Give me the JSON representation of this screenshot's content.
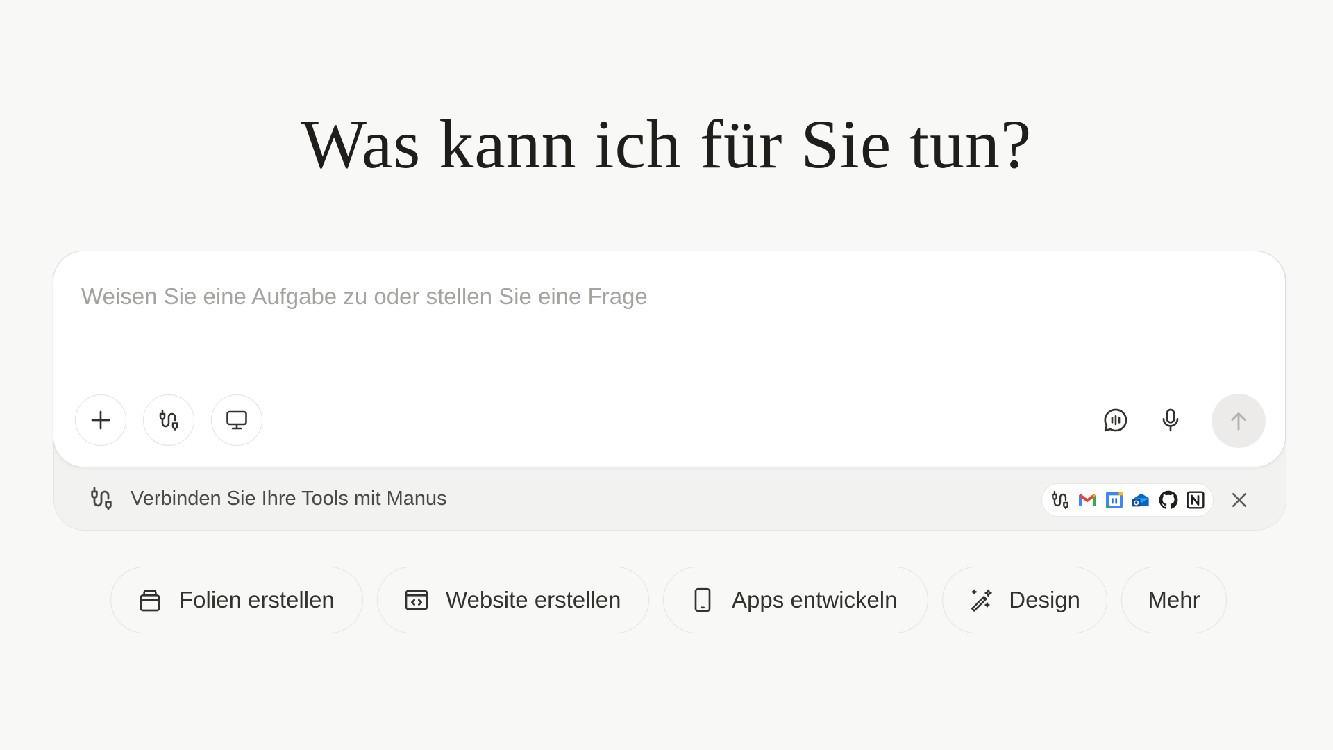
{
  "hero": {
    "title": "Was kann ich für Sie tun?"
  },
  "composer": {
    "placeholder": "Weisen Sie eine Aufgabe zu oder stellen Sie eine Frage",
    "value": "",
    "left_buttons": [
      {
        "name": "add-button",
        "icon": "plus-icon"
      },
      {
        "name": "connect-tools-button",
        "icon": "plug-connector-icon"
      },
      {
        "name": "computer-button",
        "icon": "monitor-icon"
      }
    ],
    "right_buttons": [
      {
        "name": "speech-button",
        "icon": "speech-bubble-audio-icon"
      },
      {
        "name": "microphone-button",
        "icon": "microphone-icon"
      },
      {
        "name": "send-button",
        "icon": "arrow-up-icon"
      }
    ]
  },
  "connect_bar": {
    "text": "Verbinden Sie Ihre Tools mit Manus",
    "tool_icons": [
      "connector-icon",
      "gmail-icon",
      "google-calendar-icon",
      "outlook-icon",
      "github-icon",
      "notion-icon"
    ],
    "close_icon": "close-icon"
  },
  "suggestions": [
    {
      "label": "Folien erstellen",
      "icon": "slides-icon"
    },
    {
      "label": "Website erstellen",
      "icon": "browser-code-icon"
    },
    {
      "label": "Apps entwickeln",
      "icon": "mobile-phone-icon"
    },
    {
      "label": "Design",
      "icon": "magic-pen-icon"
    },
    {
      "label": "Mehr",
      "icon": ""
    }
  ],
  "colors": {
    "background": "#f8f8f7",
    "text": "#34322d",
    "placeholder": "#a3a3a0",
    "send_button_bg": "#ecebe9"
  }
}
